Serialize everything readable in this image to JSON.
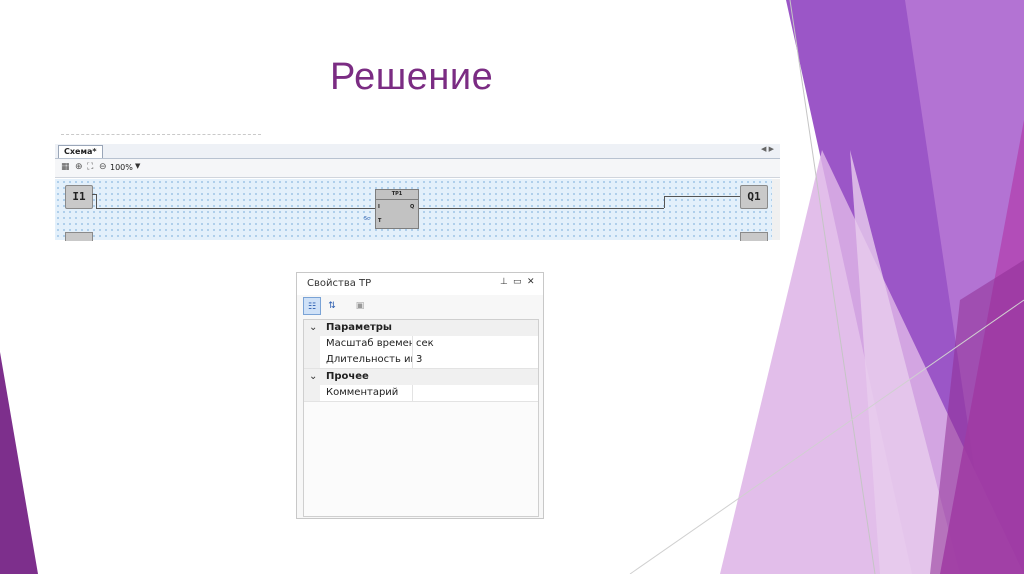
{
  "slide": {
    "title": "Решение",
    "colors": {
      "title": "#7b2c83",
      "purple_dark": "#7d2f8c",
      "purple_mid": "#9b56c7",
      "purple_light": "#d7a9e3",
      "magenta": "#b246b3"
    }
  },
  "diagram": {
    "tab_label": "Схема*",
    "toolbar": {
      "zoom_level": "100%",
      "icons": [
        "grid-icon",
        "zoom-in-icon",
        "fit-icon",
        "zoom-out-icon",
        "chevron-down-icon"
      ]
    },
    "inputs": [
      {
        "label": "I1"
      }
    ],
    "outputs": [
      {
        "label": "Q1"
      }
    ],
    "block": {
      "name": "TP1",
      "pins_in": [
        "I",
        "T"
      ],
      "pins_out": [
        "Q"
      ],
      "t_param": "5с"
    }
  },
  "properties_panel": {
    "title": "Свойства TP",
    "header_icons": [
      "pin-icon",
      "maximize-icon",
      "close-icon"
    ],
    "toolbar_icons": [
      "categorized-icon",
      "sort-alpha-icon",
      "property-pages-icon"
    ],
    "categories": [
      {
        "label": "Параметры",
        "rows": [
          {
            "name": "Масштаб времен",
            "value": "сек"
          },
          {
            "name": "Длительность им",
            "value": "3"
          }
        ]
      },
      {
        "label": "Прочее",
        "rows": [
          {
            "name": "Комментарий",
            "value": ""
          }
        ]
      }
    ]
  }
}
